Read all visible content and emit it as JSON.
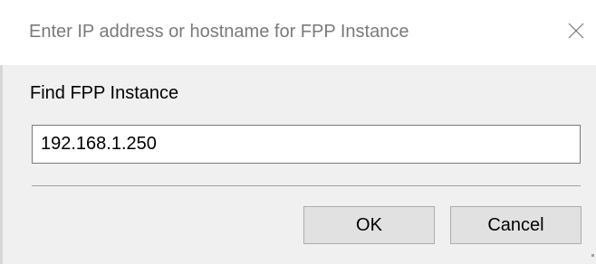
{
  "window": {
    "title": "Enter IP address or hostname for FPP Instance",
    "close_icon": "close-icon"
  },
  "form": {
    "label": "Find FPP Instance",
    "input_value": "192.168.1.250"
  },
  "buttons": {
    "ok_label": "OK",
    "cancel_label": "Cancel"
  },
  "colors": {
    "dialog_background": "#f0f0f0",
    "titlebar_background": "#ffffff",
    "button_face": "#e1e1e1",
    "button_border": "#adadad"
  }
}
